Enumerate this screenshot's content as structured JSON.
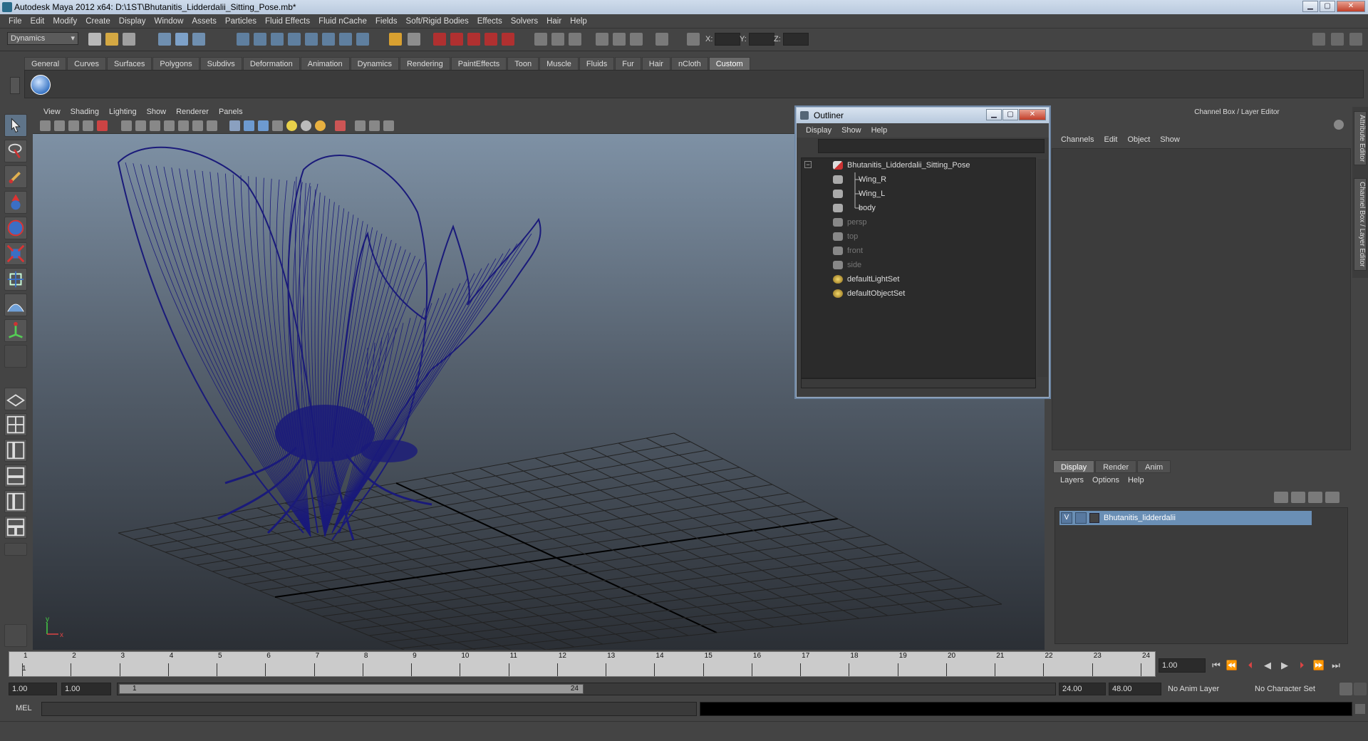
{
  "window": {
    "title": "Autodesk Maya 2012 x64: D:\\1ST\\Bhutanitis_Lidderdalii_Sitting_Pose.mb*"
  },
  "menubar": [
    "File",
    "Edit",
    "Modify",
    "Create",
    "Display",
    "Window",
    "Assets",
    "Particles",
    "Fluid Effects",
    "Fluid nCache",
    "Fields",
    "Soft/Rigid Bodies",
    "Effects",
    "Solvers",
    "Hair",
    "Help"
  ],
  "status_line": {
    "menu_set": "Dynamics",
    "x_label": "X:",
    "y_label": "Y:",
    "z_label": "Z:"
  },
  "shelf_tabs": [
    "General",
    "Curves",
    "Surfaces",
    "Polygons",
    "Subdivs",
    "Deformation",
    "Animation",
    "Dynamics",
    "Rendering",
    "PaintEffects",
    "Toon",
    "Muscle",
    "Fluids",
    "Fur",
    "Hair",
    "nCloth",
    "Custom"
  ],
  "shelf_active": "Custom",
  "viewport": {
    "menu": [
      "View",
      "Shading",
      "Lighting",
      "Show",
      "Renderer",
      "Panels"
    ],
    "wire_color": "#1a1a7a",
    "axis_labels": {
      "x": "x",
      "y": "y"
    }
  },
  "outliner": {
    "title": "Outliner",
    "menu": [
      "Display",
      "Show",
      "Help"
    ],
    "items": [
      {
        "label": "Bhutanitis_Lidderdalii_Sitting_Pose",
        "type": "group",
        "expanded": true
      },
      {
        "label": "Wing_R",
        "type": "mesh",
        "child": true
      },
      {
        "label": "Wing_L",
        "type": "mesh",
        "child": true
      },
      {
        "label": "body",
        "type": "mesh",
        "child": true
      },
      {
        "label": "persp",
        "type": "camera",
        "dim": true
      },
      {
        "label": "top",
        "type": "camera",
        "dim": true
      },
      {
        "label": "front",
        "type": "camera",
        "dim": true
      },
      {
        "label": "side",
        "type": "camera",
        "dim": true
      },
      {
        "label": "defaultLightSet",
        "type": "set"
      },
      {
        "label": "defaultObjectSet",
        "type": "set"
      }
    ]
  },
  "channel_box": {
    "title": "Channel Box / Layer Editor",
    "menu": [
      "Channels",
      "Edit",
      "Object",
      "Show"
    ]
  },
  "side_tabs": [
    "Attribute Editor",
    "Channel Box / Layer Editor"
  ],
  "layer_editor": {
    "tabs": [
      "Display",
      "Render",
      "Anim"
    ],
    "active_tab": "Display",
    "menu": [
      "Layers",
      "Options",
      "Help"
    ],
    "layers": [
      {
        "visible": "V",
        "name": "Bhutanitis_lidderdalii"
      }
    ]
  },
  "time_slider": {
    "ticks": [
      "1",
      "2",
      "3",
      "4",
      "5",
      "6",
      "7",
      "8",
      "9",
      "10",
      "11",
      "12",
      "13",
      "14",
      "15",
      "16",
      "17",
      "18",
      "19",
      "20",
      "21",
      "22",
      "23",
      "24"
    ],
    "current_frame_marker": "1",
    "current_time": "1.00"
  },
  "range_slider": {
    "anim_start": "1.00",
    "range_start": "1.00",
    "handle_start": "1",
    "handle_end": "24",
    "range_end": "24.00",
    "anim_end": "48.00",
    "anim_layer": "No Anim Layer",
    "character_set": "No Character Set"
  },
  "command_line": {
    "label": "MEL"
  }
}
